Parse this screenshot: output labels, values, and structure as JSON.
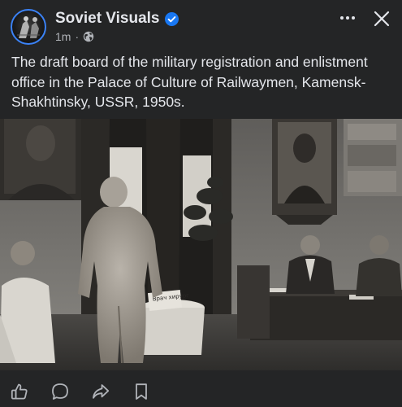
{
  "post": {
    "author": "Soviet Visuals",
    "verified": true,
    "timestamp": "1m",
    "separator": "·",
    "audience_icon": "globe-icon",
    "caption": "The draft board of the military registration and enlistment office in the Palace of Culture of Railwaymen, Kamensk-Shakhtinsky, USSR, 1950s."
  },
  "header": {
    "more_icon": "more-horizontal-icon",
    "close_icon": "close-icon"
  },
  "actions": [
    {
      "icon": "like-icon"
    },
    {
      "icon": "comment-icon"
    },
    {
      "icon": "share-icon"
    },
    {
      "icon": "bookmark-icon"
    }
  ],
  "photo": {
    "sign_text": "Врач хирург"
  },
  "colors": {
    "background": "#242526",
    "text_primary": "#e4e6eb",
    "text_secondary": "#b0b3b8",
    "verified_badge": "#1877f2"
  }
}
